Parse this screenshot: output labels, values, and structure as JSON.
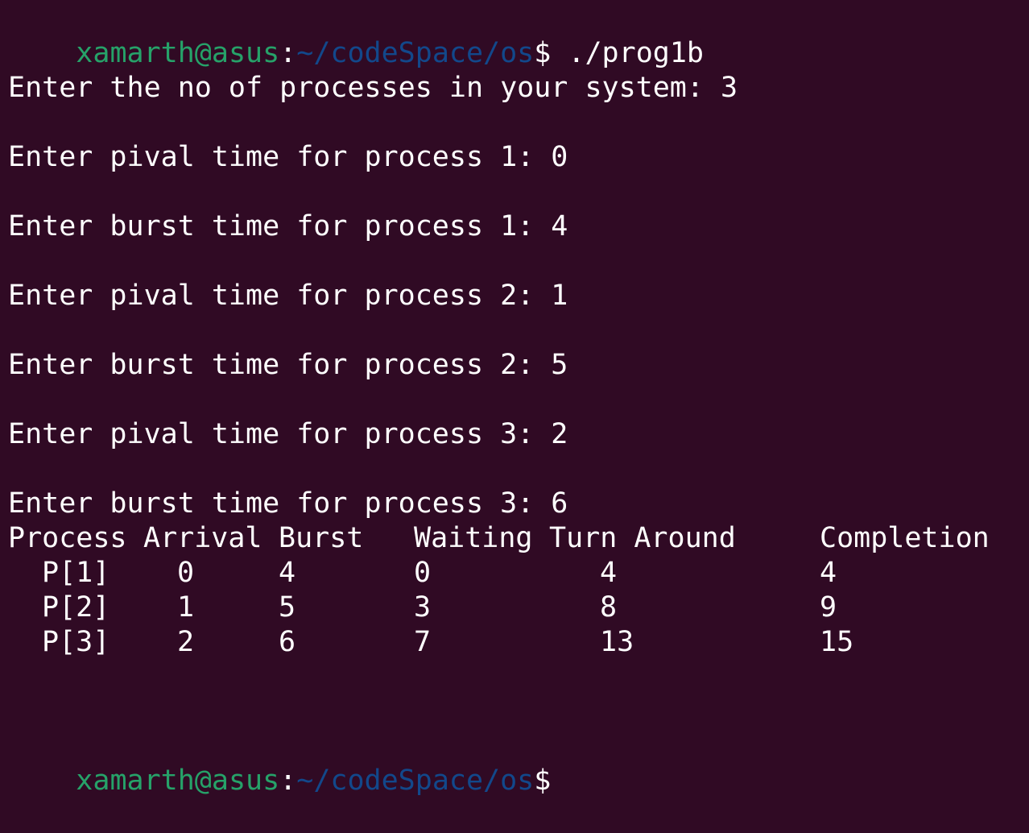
{
  "colors": {
    "background": "#300a24",
    "prompt_user": "#26a269",
    "prompt_path": "#12488b",
    "text": "#ffffff"
  },
  "prompt": {
    "user_host": "xamarth@asus",
    "colon": ":",
    "path": "~/codeSpace/os",
    "dollar": "$",
    "command": " ./prog1b"
  },
  "output": {
    "num_processes": "Enter the no of processes in your system: 3",
    "inputs": [
      "Enter pival time for process 1: 0",
      "Enter burst time for process 1: 4",
      "Enter pival time for process 2: 1",
      "Enter burst time for process 2: 5",
      "Enter pival time for process 3: 2",
      "Enter burst time for process 3: 6"
    ]
  },
  "table": {
    "headers": [
      "Process",
      "Arrival",
      "Burst",
      "Waiting",
      "Turn Around",
      "Completion"
    ],
    "rows": [
      [
        "P[1]",
        "0",
        "4",
        "0",
        "4",
        "4"
      ],
      [
        "P[2]",
        "1",
        "5",
        "3",
        "8",
        "9"
      ],
      [
        "P[3]",
        "2",
        "6",
        "7",
        "13",
        "15"
      ]
    ]
  },
  "final_prompt": {
    "user_host": "xamarth@asus",
    "colon": ":",
    "path": "~/codeSpace/os",
    "dollar": "$"
  }
}
